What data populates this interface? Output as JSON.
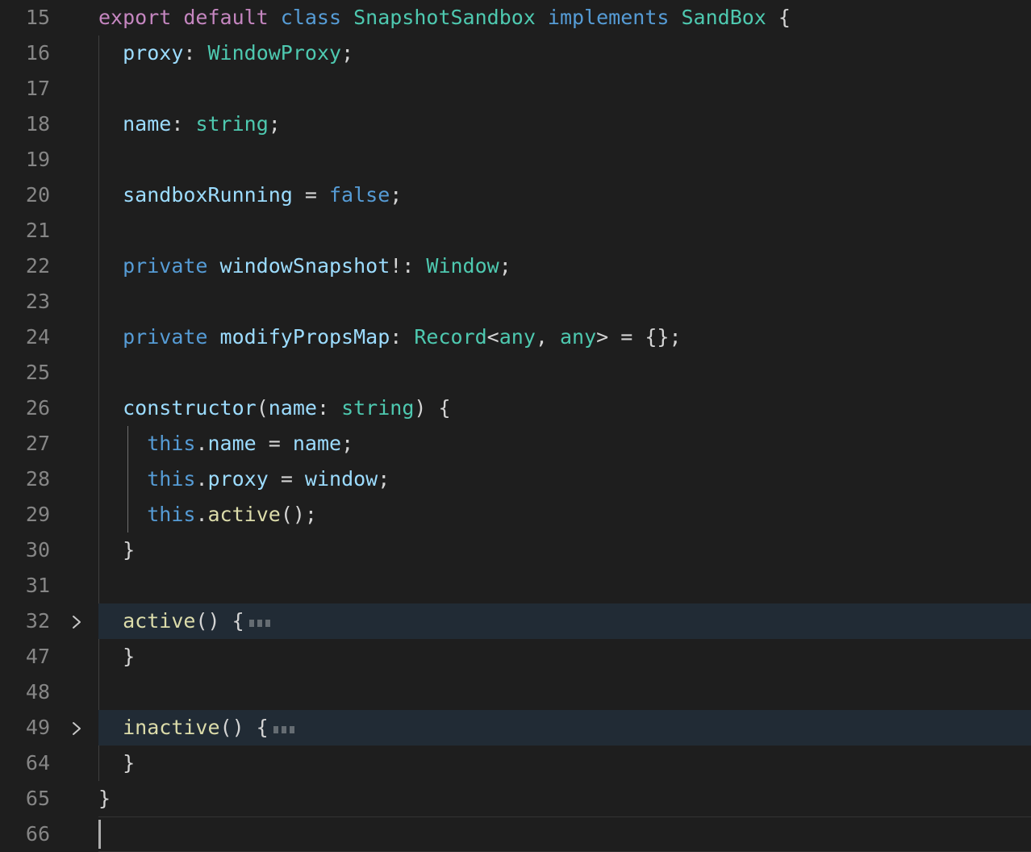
{
  "editor": {
    "app": "code-editor",
    "language": "TypeScript",
    "background_color": "#1e1e1e",
    "folded_line_color": "#212b35",
    "current_line_border_color": "#333333",
    "line_number_color": "#868686",
    "cursor_color": "#aeaeae",
    "indent_guide_color": "#404040",
    "active_indent_guide_color": "#707070",
    "cursor_line": "66",
    "fold_placeholder": "⋯",
    "colors": {
      "keyword": "#569cd6",
      "control": "#c586c0",
      "type": "#4ec9b0",
      "variable": "#9cdcfe",
      "function": "#dcdcaa",
      "plain": "#d4d4d4"
    },
    "lines": [
      {
        "number": "15",
        "folded": false,
        "current": false,
        "chevron": null,
        "indent_guides": [],
        "tokens": [
          {
            "text": "export default ",
            "kind": "control"
          },
          {
            "text": "class ",
            "kind": "keyword"
          },
          {
            "text": "SnapshotSandbox ",
            "kind": "type"
          },
          {
            "text": "implements ",
            "kind": "keyword"
          },
          {
            "text": "SandBox ",
            "kind": "type"
          },
          {
            "text": "{",
            "kind": "plain"
          }
        ]
      },
      {
        "number": "16",
        "folded": false,
        "current": false,
        "chevron": null,
        "indent_guides": [
          1
        ],
        "tokens": [
          {
            "text": "  ",
            "kind": "plain"
          },
          {
            "text": "proxy",
            "kind": "var"
          },
          {
            "text": ": ",
            "kind": "plain"
          },
          {
            "text": "WindowProxy",
            "kind": "type"
          },
          {
            "text": ";",
            "kind": "plain"
          }
        ]
      },
      {
        "number": "17",
        "folded": false,
        "current": false,
        "chevron": null,
        "indent_guides": [
          1
        ],
        "tokens": []
      },
      {
        "number": "18",
        "folded": false,
        "current": false,
        "chevron": null,
        "indent_guides": [
          1
        ],
        "tokens": [
          {
            "text": "  ",
            "kind": "plain"
          },
          {
            "text": "name",
            "kind": "var"
          },
          {
            "text": ": ",
            "kind": "plain"
          },
          {
            "text": "string",
            "kind": "type"
          },
          {
            "text": ";",
            "kind": "plain"
          }
        ]
      },
      {
        "number": "19",
        "folded": false,
        "current": false,
        "chevron": null,
        "indent_guides": [
          1
        ],
        "tokens": []
      },
      {
        "number": "20",
        "folded": false,
        "current": false,
        "chevron": null,
        "indent_guides": [
          1
        ],
        "tokens": [
          {
            "text": "  ",
            "kind": "plain"
          },
          {
            "text": "sandboxRunning",
            "kind": "var"
          },
          {
            "text": " = ",
            "kind": "plain"
          },
          {
            "text": "false",
            "kind": "keyword"
          },
          {
            "text": ";",
            "kind": "plain"
          }
        ]
      },
      {
        "number": "21",
        "folded": false,
        "current": false,
        "chevron": null,
        "indent_guides": [
          1
        ],
        "tokens": []
      },
      {
        "number": "22",
        "folded": false,
        "current": false,
        "chevron": null,
        "indent_guides": [
          1
        ],
        "tokens": [
          {
            "text": "  ",
            "kind": "plain"
          },
          {
            "text": "private",
            "kind": "keyword"
          },
          {
            "text": " ",
            "kind": "plain"
          },
          {
            "text": "windowSnapshot",
            "kind": "var"
          },
          {
            "text": "!: ",
            "kind": "plain"
          },
          {
            "text": "Window",
            "kind": "type"
          },
          {
            "text": ";",
            "kind": "plain"
          }
        ]
      },
      {
        "number": "23",
        "folded": false,
        "current": false,
        "chevron": null,
        "indent_guides": [
          1
        ],
        "tokens": []
      },
      {
        "number": "24",
        "folded": false,
        "current": false,
        "chevron": null,
        "indent_guides": [
          1
        ],
        "tokens": [
          {
            "text": "  ",
            "kind": "plain"
          },
          {
            "text": "private",
            "kind": "keyword"
          },
          {
            "text": " ",
            "kind": "plain"
          },
          {
            "text": "modifyPropsMap",
            "kind": "var"
          },
          {
            "text": ": ",
            "kind": "plain"
          },
          {
            "text": "Record",
            "kind": "type"
          },
          {
            "text": "<",
            "kind": "plain"
          },
          {
            "text": "any",
            "kind": "type"
          },
          {
            "text": ", ",
            "kind": "plain"
          },
          {
            "text": "any",
            "kind": "type"
          },
          {
            "text": "> = {};",
            "kind": "plain"
          }
        ]
      },
      {
        "number": "25",
        "folded": false,
        "current": false,
        "chevron": null,
        "indent_guides": [
          1
        ],
        "tokens": []
      },
      {
        "number": "26",
        "folded": false,
        "current": false,
        "chevron": null,
        "indent_guides": [
          1
        ],
        "tokens": [
          {
            "text": "  ",
            "kind": "plain"
          },
          {
            "text": "constructor",
            "kind": "var"
          },
          {
            "text": "(",
            "kind": "plain"
          },
          {
            "text": "name",
            "kind": "var"
          },
          {
            "text": ": ",
            "kind": "plain"
          },
          {
            "text": "string",
            "kind": "type"
          },
          {
            "text": ") {",
            "kind": "plain"
          }
        ]
      },
      {
        "number": "27",
        "folded": false,
        "current": false,
        "chevron": null,
        "indent_guides": [
          1,
          2
        ],
        "tokens": [
          {
            "text": "    ",
            "kind": "plain"
          },
          {
            "text": "this",
            "kind": "keyword"
          },
          {
            "text": ".",
            "kind": "plain"
          },
          {
            "text": "name",
            "kind": "var"
          },
          {
            "text": " = ",
            "kind": "plain"
          },
          {
            "text": "name",
            "kind": "var"
          },
          {
            "text": ";",
            "kind": "plain"
          }
        ]
      },
      {
        "number": "28",
        "folded": false,
        "current": false,
        "chevron": null,
        "indent_guides": [
          1,
          2
        ],
        "tokens": [
          {
            "text": "    ",
            "kind": "plain"
          },
          {
            "text": "this",
            "kind": "keyword"
          },
          {
            "text": ".",
            "kind": "plain"
          },
          {
            "text": "proxy",
            "kind": "var"
          },
          {
            "text": " = ",
            "kind": "plain"
          },
          {
            "text": "window",
            "kind": "var"
          },
          {
            "text": ";",
            "kind": "plain"
          }
        ]
      },
      {
        "number": "29",
        "folded": false,
        "current": false,
        "chevron": null,
        "indent_guides": [
          1,
          2
        ],
        "tokens": [
          {
            "text": "    ",
            "kind": "plain"
          },
          {
            "text": "this",
            "kind": "keyword"
          },
          {
            "text": ".",
            "kind": "plain"
          },
          {
            "text": "active",
            "kind": "func"
          },
          {
            "text": "();",
            "kind": "plain"
          }
        ]
      },
      {
        "number": "30",
        "folded": false,
        "current": false,
        "chevron": null,
        "indent_guides": [
          1
        ],
        "tokens": [
          {
            "text": "  }",
            "kind": "plain"
          }
        ]
      },
      {
        "number": "31",
        "folded": false,
        "current": false,
        "chevron": null,
        "indent_guides": [
          1
        ],
        "tokens": []
      },
      {
        "number": "32",
        "folded": true,
        "current": false,
        "chevron": "chevron-right",
        "indent_guides": [],
        "tokens": [
          {
            "text": "  ",
            "kind": "plain"
          },
          {
            "text": "active",
            "kind": "func"
          },
          {
            "text": "() {",
            "kind": "plain"
          }
        ]
      },
      {
        "number": "47",
        "folded": false,
        "current": false,
        "chevron": null,
        "indent_guides": [
          1
        ],
        "tokens": [
          {
            "text": "  }",
            "kind": "plain"
          }
        ]
      },
      {
        "number": "48",
        "folded": false,
        "current": false,
        "chevron": null,
        "indent_guides": [
          1
        ],
        "tokens": []
      },
      {
        "number": "49",
        "folded": true,
        "current": false,
        "chevron": "chevron-right",
        "indent_guides": [],
        "tokens": [
          {
            "text": "  ",
            "kind": "plain"
          },
          {
            "text": "inactive",
            "kind": "func"
          },
          {
            "text": "() {",
            "kind": "plain"
          }
        ]
      },
      {
        "number": "64",
        "folded": false,
        "current": false,
        "chevron": null,
        "indent_guides": [
          1
        ],
        "tokens": [
          {
            "text": "  }",
            "kind": "plain"
          }
        ]
      },
      {
        "number": "65",
        "folded": false,
        "current": false,
        "chevron": null,
        "indent_guides": [],
        "tokens": [
          {
            "text": "}",
            "kind": "plain"
          }
        ]
      },
      {
        "number": "66",
        "folded": false,
        "current": true,
        "chevron": null,
        "indent_guides": [],
        "tokens": []
      }
    ]
  }
}
